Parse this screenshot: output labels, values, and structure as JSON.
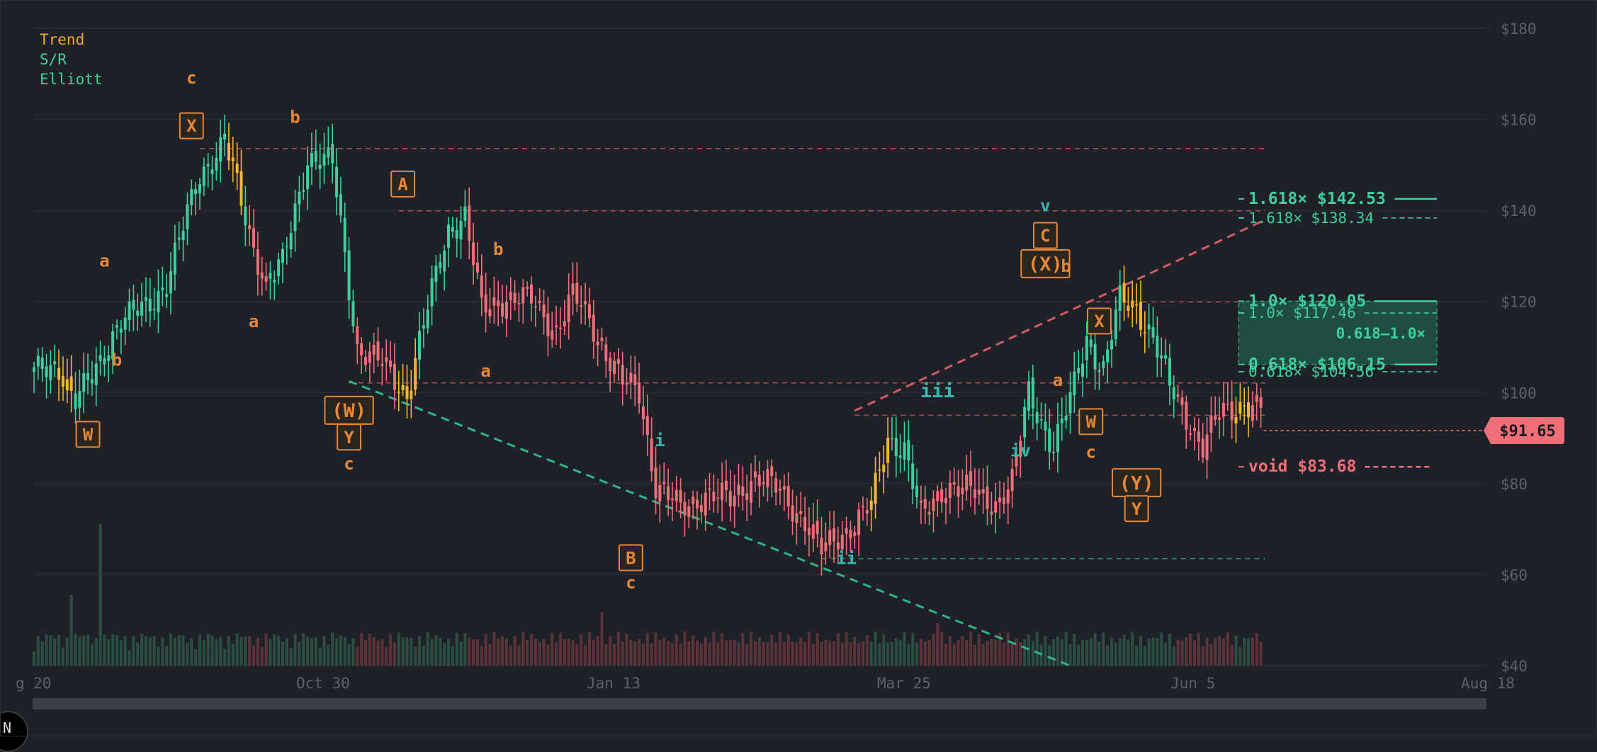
{
  "legend": {
    "trend": {
      "label": "Trend",
      "color": "#e8a93c"
    },
    "sr": {
      "label": "S/R",
      "color": "#3fcf9c"
    },
    "elliott": {
      "label": "Elliott",
      "color": "#3fcf9c"
    }
  },
  "colors": {
    "background": "#1f2128",
    "grid": "#2a2d35",
    "bull": "#3fcf9c",
    "bear": "#ef6f78",
    "neutral": "#f5b72b",
    "wave_orange": "#e5883a",
    "wave_cyan": "#3bb7b0",
    "resistance": "#c9565f",
    "support": "#2c9e7a",
    "axis_text": "#5d6069"
  },
  "price_tag": {
    "label": "$91.65",
    "value": 91.65,
    "color": "#ef6f78"
  },
  "chart_data": {
    "type": "candlestick",
    "y_axis": {
      "range": [
        40,
        180
      ],
      "ticks": [
        "$40",
        "$60",
        "$80",
        "$100",
        "$120",
        "$140",
        "$160",
        "$180"
      ],
      "position": "right"
    },
    "x_axis": {
      "tick_labels": [
        "g 20",
        "Oct 30",
        "Jan 13",
        "Mar 25",
        "Jun 5",
        "Aug 18"
      ]
    },
    "grid": true,
    "price_path": [
      [
        0,
        104
      ],
      [
        6,
        106
      ],
      [
        10,
        98
      ],
      [
        14,
        103
      ],
      [
        20,
        115
      ],
      [
        26,
        118
      ],
      [
        32,
        124
      ],
      [
        40,
        148
      ],
      [
        46,
        155
      ],
      [
        52,
        135
      ],
      [
        56,
        124
      ],
      [
        60,
        128
      ],
      [
        66,
        152
      ],
      [
        72,
        150
      ],
      [
        78,
        110
      ],
      [
        84,
        106
      ],
      [
        90,
        100
      ],
      [
        96,
        122
      ],
      [
        100,
        136
      ],
      [
        104,
        139
      ],
      [
        108,
        118
      ],
      [
        114,
        121
      ],
      [
        120,
        120
      ],
      [
        126,
        114
      ],
      [
        130,
        121
      ],
      [
        134,
        116
      ],
      [
        142,
        102
      ],
      [
        146,
        100
      ],
      [
        150,
        80
      ],
      [
        156,
        74
      ],
      [
        162,
        78
      ],
      [
        168,
        76
      ],
      [
        174,
        82
      ],
      [
        180,
        78
      ],
      [
        186,
        72
      ],
      [
        190,
        65
      ],
      [
        196,
        70
      ],
      [
        202,
        75
      ],
      [
        206,
        90
      ],
      [
        210,
        88
      ],
      [
        214,
        72
      ],
      [
        220,
        80
      ],
      [
        226,
        78
      ],
      [
        232,
        76
      ],
      [
        236,
        80
      ],
      [
        240,
        100
      ],
      [
        246,
        88
      ],
      [
        250,
        98
      ],
      [
        254,
        112
      ],
      [
        258,
        105
      ],
      [
        262,
        120
      ],
      [
        266,
        119
      ],
      [
        270,
        112
      ],
      [
        274,
        101
      ],
      [
        278,
        95
      ],
      [
        282,
        88
      ],
      [
        286,
        95
      ],
      [
        292,
        98
      ],
      [
        296,
        96
      ]
    ],
    "resistance_lines": [
      {
        "value": 153.6,
        "from": 40,
        "to": 296
      },
      {
        "value": 139.9,
        "from": 88,
        "to": 296
      },
      {
        "value": 119.9,
        "from": 254,
        "to": 296
      },
      {
        "value": 102.1,
        "from": 76,
        "to": 296
      },
      {
        "value": 95.0,
        "from": 198,
        "to": 296
      }
    ],
    "support_lines": [
      {
        "value": 63.5,
        "from": 190,
        "to": 296
      }
    ],
    "trendlines": [
      {
        "kind": "support",
        "from": [
          76,
          102.5
        ],
        "to": [
          250,
          40
        ]
      },
      {
        "kind": "resistance",
        "from": [
          198,
          96
        ],
        "to": [
          296,
          137.5
        ]
      }
    ],
    "targets": [
      {
        "label": "1.618× $142.53",
        "value": 142.53,
        "color": "#3fcf9c",
        "style": "solid",
        "bold": true
      },
      {
        "label": "1.618× $138.34",
        "value": 138.34,
        "color": "#3fcf9c",
        "style": "dashed",
        "bold": false
      },
      {
        "label": "1.0× $120.05",
        "value": 120.05,
        "color": "#3fcf9c",
        "style": "solid",
        "bold": true
      },
      {
        "label": "1.0× $117.46",
        "value": 117.46,
        "color": "#3fcf9c",
        "style": "dashed",
        "bold": false
      },
      {
        "label": "0.618× $106.15",
        "value": 106.15,
        "color": "#3fcf9c",
        "style": "solid",
        "bold": true
      },
      {
        "label": "0.618× $104.56",
        "value": 104.56,
        "color": "#3fcf9c",
        "style": "dashed",
        "bold": false
      },
      {
        "label": "void $83.68",
        "value": 83.68,
        "color": "#ef6f78",
        "style": "dashed",
        "bold": true
      }
    ],
    "target_zone": {
      "label": "0.618–1.0×",
      "low": 106.15,
      "high": 120.05
    },
    "wave_labels": [
      {
        "text": "W",
        "bar": 13,
        "value": 90.8,
        "boxed": true,
        "color": "#e5883a"
      },
      {
        "text": "a",
        "bar": 17,
        "value": 129.0,
        "boxed": false,
        "color": "#e5883a"
      },
      {
        "text": "b",
        "bar": 20,
        "value": 107.2,
        "boxed": false,
        "color": "#e5883a"
      },
      {
        "text": "c",
        "bar": 38,
        "value": 169.2,
        "boxed": false,
        "color": "#e5883a"
      },
      {
        "text": "X",
        "bar": 38,
        "value": 158.6,
        "boxed": true,
        "color": "#e5883a"
      },
      {
        "text": "b",
        "bar": 63,
        "value": 160.6,
        "boxed": false,
        "color": "#e5883a"
      },
      {
        "text": "a",
        "bar": 53,
        "value": 115.7,
        "boxed": false,
        "color": "#e5883a"
      },
      {
        "text": "(W)",
        "bar": 76,
        "value": 96.1,
        "boxed": true,
        "color": "#e5883a"
      },
      {
        "text": "Y",
        "bar": 76,
        "value": 90.2,
        "boxed": true,
        "color": "#e5883a"
      },
      {
        "text": "c",
        "bar": 76,
        "value": 84.4,
        "boxed": false,
        "color": "#e5883a"
      },
      {
        "text": "A",
        "bar": 89,
        "value": 145.8,
        "boxed": true,
        "color": "#e5883a"
      },
      {
        "text": "b",
        "bar": 112,
        "value": 131.6,
        "boxed": false,
        "color": "#e5883a"
      },
      {
        "text": "a",
        "bar": 109,
        "value": 104.8,
        "boxed": false,
        "color": "#e5883a"
      },
      {
        "text": "i",
        "bar": 151,
        "value": 89.6,
        "boxed": false,
        "color": "#3bb7b0"
      },
      {
        "text": "B",
        "bar": 144,
        "value": 63.7,
        "boxed": true,
        "color": "#e5883a"
      },
      {
        "text": "c",
        "bar": 144,
        "value": 58.3,
        "boxed": false,
        "color": "#e5883a"
      },
      {
        "text": "ii",
        "bar": 196,
        "value": 63.7,
        "boxed": false,
        "color": "#3bb7b0"
      },
      {
        "text": "iii",
        "bar": 218,
        "value": 100.5,
        "boxed": false,
        "color": "#3bb7b0"
      },
      {
        "text": "iv",
        "bar": 238,
        "value": 87.3,
        "boxed": false,
        "color": "#3bb7b0"
      },
      {
        "text": "v",
        "bar": 244,
        "value": 141.1,
        "boxed": false,
        "color": "#3bb7b0"
      },
      {
        "text": "C",
        "bar": 244,
        "value": 134.5,
        "boxed": true,
        "color": "#e5883a"
      },
      {
        "text": "(X)",
        "bar": 244,
        "value": 128.3,
        "boxed": true,
        "color": "#e5883a"
      },
      {
        "text": "b",
        "bar": 249,
        "value": 127.8,
        "boxed": false,
        "color": "#e5883a"
      },
      {
        "text": "X",
        "bar": 257,
        "value": 115.7,
        "boxed": true,
        "color": "#e5883a"
      },
      {
        "text": "a",
        "bar": 247,
        "value": 102.8,
        "boxed": false,
        "color": "#e5883a"
      },
      {
        "text": "W",
        "bar": 255,
        "value": 93.6,
        "boxed": true,
        "color": "#e5883a"
      },
      {
        "text": "c",
        "bar": 255,
        "value": 87.0,
        "boxed": false,
        "color": "#e5883a"
      },
      {
        "text": "(Y)",
        "bar": 266,
        "value": 80.2,
        "boxed": true,
        "color": "#e5883a"
      },
      {
        "text": "Y",
        "bar": 266,
        "value": 74.5,
        "boxed": true,
        "color": "#e5883a"
      }
    ]
  }
}
